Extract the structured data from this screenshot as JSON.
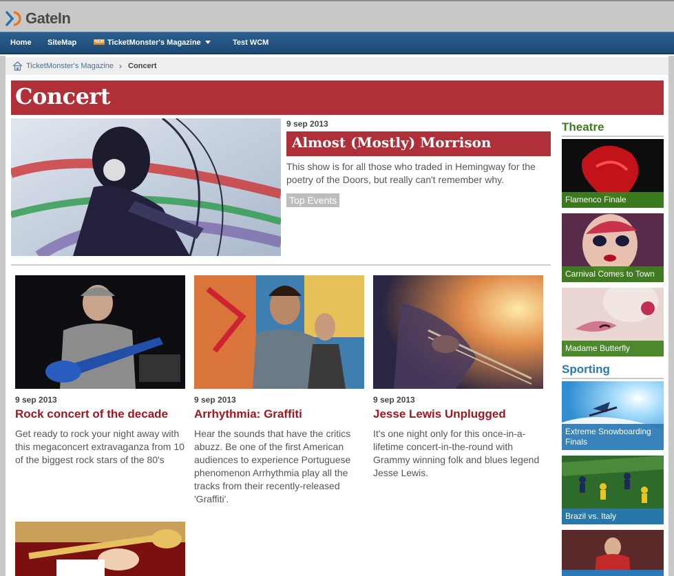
{
  "header": {
    "logo_text": "GateIn"
  },
  "nav": {
    "items": [
      {
        "label": "Home"
      },
      {
        "label": "SiteMap"
      },
      {
        "label": "TicketMonster's Magazine",
        "badge": "NEW"
      },
      {
        "label": "Test WCM"
      }
    ]
  },
  "breadcrumb": {
    "parent": "TicketMonster's Magazine",
    "current": "Concert"
  },
  "page": {
    "title": "Concert"
  },
  "featured": {
    "date": "9 sep 2013",
    "title": "Almost (Mostly) Morrison",
    "description": "This show is for all those who traded in Hemingway for the poetry of the Doors, but really can't remember why.",
    "tag": "Top Events"
  },
  "articles": [
    {
      "date": "9 sep 2013",
      "title": "Rock concert of the decade",
      "description": "Get ready to rock your night away with this megaconcert extravaganza from 10 of the biggest rock stars of the 80's"
    },
    {
      "date": "9 sep 2013",
      "title": "Arrhythmia: Graffiti",
      "description": "Hear the sounds that have the critics abuzz. Be one of the first American audiences to experience Portuguese phenomenon Arrhythmia play all the tracks from their recently-released 'Graffiti'."
    },
    {
      "date": "9 sep 2013",
      "title": "Jesse Lewis Unplugged",
      "description": "It's one night only for this once-in-a-lifetime concert-in-the-round with Grammy winning folk and blues legend Jesse Lewis."
    }
  ],
  "sidebar": {
    "theatre": {
      "heading": "Theatre",
      "color": "#3a7d1e",
      "items": [
        {
          "label": "Flamenco Finale"
        },
        {
          "label": "Carnival Comes to Town"
        },
        {
          "label": "Madame Butterfly"
        }
      ]
    },
    "sporting": {
      "heading": "Sporting",
      "color": "#2a78b8",
      "items": [
        {
          "label": "Extreme Snowboarding Finals"
        },
        {
          "label": "Brazil vs. Italy"
        }
      ]
    }
  },
  "colors": {
    "accent_red": "#b0303a",
    "title_red": "#a4161f",
    "nav_blue": "#1d4a75"
  }
}
